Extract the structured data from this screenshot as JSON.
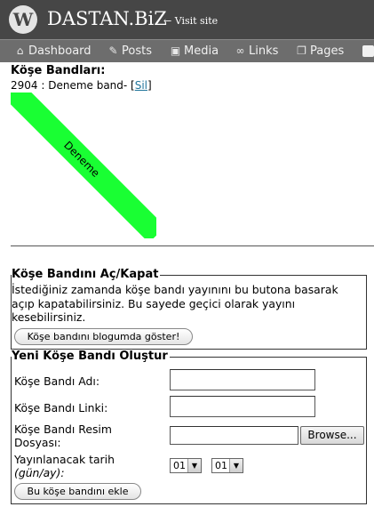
{
  "header": {
    "logo_letter": "W",
    "site_title": "DASTAN.BiZ",
    "visit_site": "← Visit site"
  },
  "menu": {
    "items": [
      {
        "label": "Dashboard",
        "icon": "house-icon"
      },
      {
        "label": "Posts",
        "icon": "pin-icon"
      },
      {
        "label": "Media",
        "icon": "media-icon"
      },
      {
        "label": "Links",
        "icon": "link-icon"
      },
      {
        "label": "Pages",
        "icon": "pages-icon"
      }
    ]
  },
  "banners": {
    "title": "Köşe Bandları:",
    "entry_text": "2904 : Deneme band- [",
    "delete_label": "Sil",
    "entry_close": "]",
    "ribbon_text": "Deneme",
    "ribbon_color": "#19ff33"
  },
  "toggle_section": {
    "legend": "Köşe Bandını Aç/Kapat",
    "description": "İstediğiniz zamanda köşe bandı yayınını bu butona basarak açıp kapatabilirsiniz. Bu sayede geçici olarak yayını kesebilirsiniz.",
    "button_label": "Köşe bandını blogumda göster!"
  },
  "create_section": {
    "legend": "Yeni Köşe Bandı Oluştur",
    "name_label": "Köşe Bandı Adı:",
    "name_value": "",
    "link_label": "Köşe Bandı Linki:",
    "link_value": "",
    "image_label_line1": "Köşe Bandı Resim",
    "image_label_line2": "Dosyası:",
    "browse_label": "Browse...",
    "date_label_line1": "Yayınlanacak tarih",
    "date_label_line2": "(gün/ay):",
    "day_value": "01",
    "month_value": "01",
    "submit_label": "Bu köşe bandını ekle"
  }
}
